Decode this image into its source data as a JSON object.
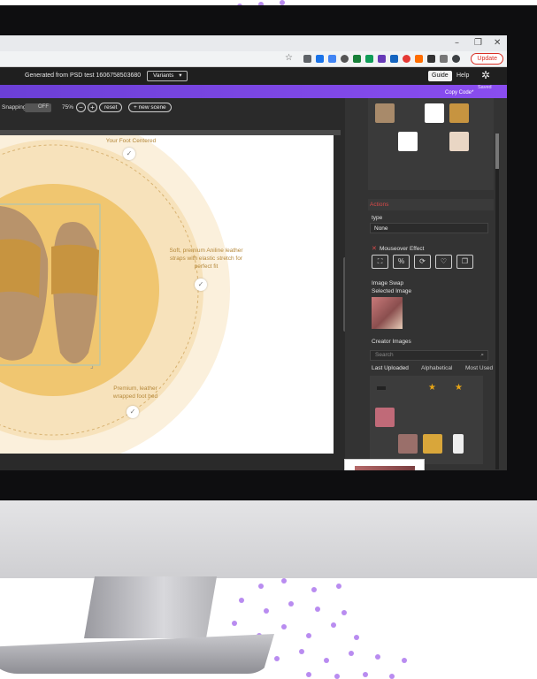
{
  "browser": {
    "minimize": "–",
    "maximize": "❐",
    "close": "✕",
    "update_button": "Update",
    "bookmark_icon": "star-icon"
  },
  "app": {
    "doc_title": "Generated from PSD test 1606758503680",
    "variants_label": "Variants",
    "variants_chevron": "▾",
    "guide_label": "Guide",
    "help_label": "Help",
    "saved_label": "Saved",
    "copy_code_label": "Copy Code*"
  },
  "editor": {
    "snapping_label": "Snapping:",
    "snapping_state": "OFF",
    "zoom_label": "75%",
    "zoom_out": "−",
    "zoom_in": "+",
    "reset_label": "reset",
    "new_scene_label": "+ new scene",
    "hotspots": [
      {
        "text": "Your Foot Centered"
      },
      {
        "text": "Soft, premium Aniline leather straps with elastic stretch for perfect fit"
      },
      {
        "text": "Premium, leather wrapped foot bed"
      }
    ],
    "check_glyph": "✓",
    "resize_glyph": "⌟"
  },
  "panel": {
    "actions_header": "Actions",
    "type_label": "type",
    "type_value": "None",
    "mouseover_label": "Mouseover Effect",
    "mouseover_icons": [
      "expand-icon",
      "percent-icon",
      "rotate-icon",
      "heart-icon",
      "layers-icon"
    ],
    "image_swap_label": "Image Swap",
    "selected_image_label": "Selected Image",
    "creator_images_label": "Creator Images",
    "search_placeholder": "Search",
    "sort_options": [
      "Last Uploaded",
      "Alphabetical",
      "Most Used"
    ]
  },
  "colors": {
    "accent": "#7b44e8",
    "canvas_bg": "#ffffff",
    "gold": "#e6a416",
    "hotspot_text": "#b5883a"
  }
}
